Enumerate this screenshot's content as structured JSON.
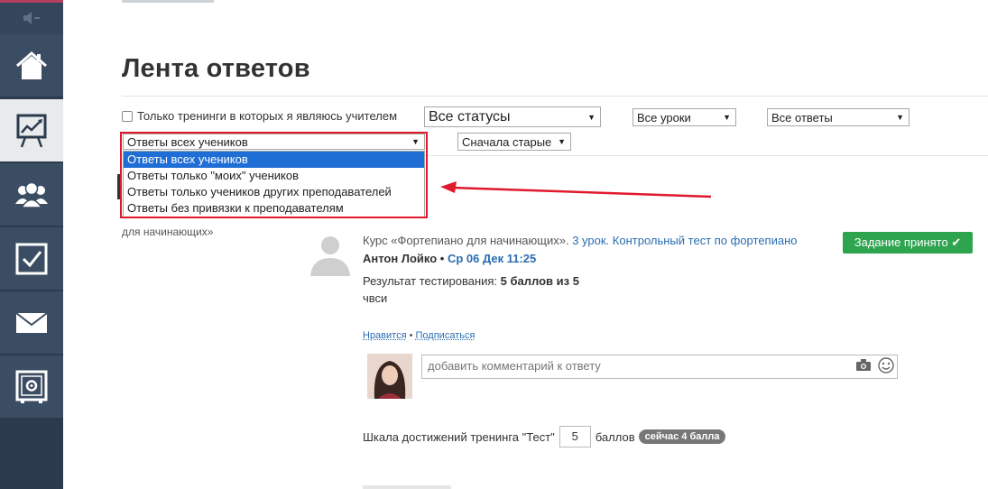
{
  "sidebar": {
    "items": [
      {
        "icon": "home-icon"
      },
      {
        "icon": "chart-presentation-icon"
      },
      {
        "icon": "users-icon"
      },
      {
        "icon": "checkbox-icon"
      },
      {
        "icon": "mail-icon"
      },
      {
        "icon": "safe-icon"
      }
    ]
  },
  "page": {
    "title": "Лента ответов"
  },
  "filters": {
    "teacher_only_label": "Только тренинги в которых я являюсь учителем",
    "status_select": "Все статусы",
    "lessons_select": "Все уроки",
    "answers_select": "Все ответы",
    "students_select": "Ответы всех учеников",
    "sort_select": "Сначала старые"
  },
  "students_dropdown": {
    "options": [
      "Ответы всех учеников",
      "Ответы только \"моих\" учеников",
      "Ответы только учеников других преподавателей",
      "Ответы без привязки к преподавателям"
    ],
    "selected_index": 0
  },
  "background": {
    "peek_text": "для начинающих»"
  },
  "answer": {
    "course_prefix": "Курс «Фортепиано для начинающих».",
    "lesson_link": "3 урок. Контрольный тест по фортепиано",
    "author": "Антон Лойко",
    "separator": " • ",
    "datetime": "Ср 06 Дек 11:25",
    "status_button": "Задание принято ✔",
    "result_label": "Результат тестирования: ",
    "result_value": "5 баллов из 5",
    "text": "чвси",
    "like_link": "Нравится",
    "dot": " • ",
    "subscribe_link": "Подписаться",
    "comment_placeholder": "добавить комментарий к ответу",
    "scale_label": "Шкала достижений тренинга \"Тест\"",
    "scale_value": "5",
    "scale_unit": "баллов",
    "scale_badge": "сейчас 4 балла"
  },
  "colors": {
    "sidebar_bg": "#2b3a4d",
    "accent_red": "#e0192d",
    "selected_blue": "#1e6ed6",
    "success_green": "#2ea44f",
    "link_blue": "#2a6db0"
  }
}
